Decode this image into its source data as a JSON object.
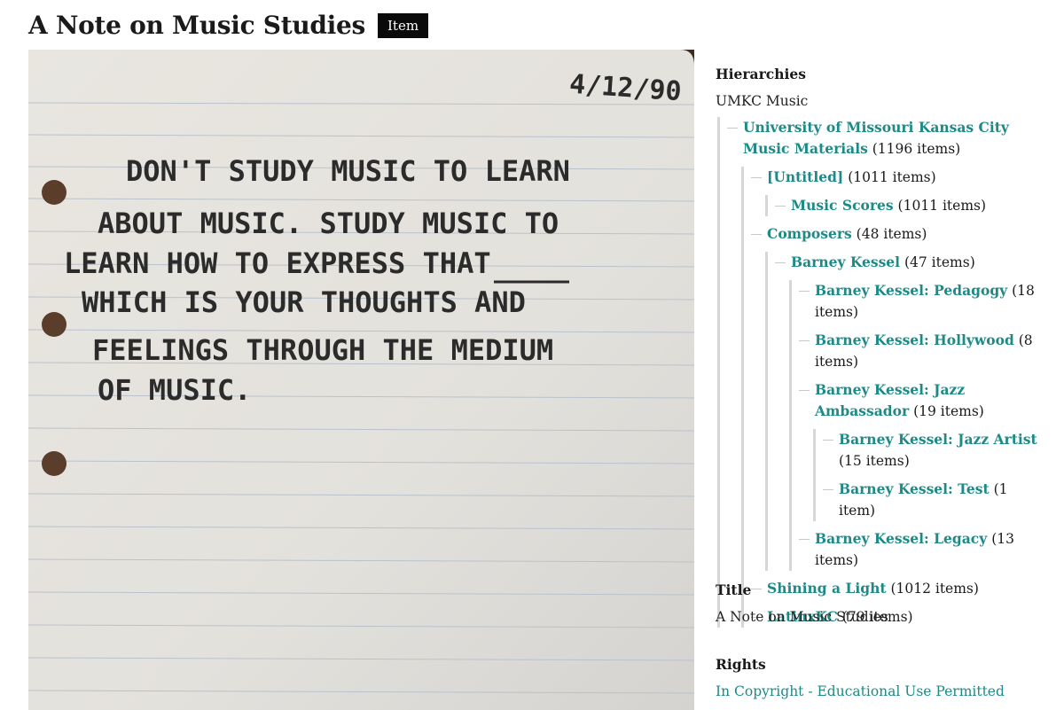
{
  "header": {
    "title": "A Note on Music Studies",
    "badge": "Item"
  },
  "image": {
    "date": "4/12/90",
    "lines": [
      "DON'T STUDY MUSIC TO LEARN",
      "ABOUT MUSIC. STUDY MUSIC TO",
      "LEARN HOW TO EXPRESS THAT",
      "WHICH IS YOUR THOUGHTS AND",
      "FEELINGS THROUGH THE MEDIUM",
      "OF MUSIC."
    ]
  },
  "sidebar": {
    "hierarchies_label": "Hierarchies",
    "root": "UMKC Music",
    "tree": {
      "umkc": {
        "label": "University of Missouri Kansas City Music Materials",
        "count": "(1196 items)"
      },
      "untitled": {
        "label": "[Untitled]",
        "count": "(1011 items)"
      },
      "scores": {
        "label": "Music Scores",
        "count": "(1011 items)"
      },
      "composers": {
        "label": "Composers",
        "count": "(48 items)"
      },
      "kessel": {
        "label": "Barney Kessel",
        "count": "(47 items)"
      },
      "pedagogy": {
        "label": "Barney Kessel: Pedagogy",
        "count": "(18 items)"
      },
      "hollywood": {
        "label": "Barney Kessel: Hollywood",
        "count": "(8 items)"
      },
      "ambassador": {
        "label": "Barney Kessel: Jazz Ambassador",
        "count": "(19 items)"
      },
      "artist": {
        "label": "Barney Kessel: Jazz Artist",
        "count": "(15 items)"
      },
      "test": {
        "label": "Barney Kessel: Test",
        "count": "(1 item)"
      },
      "legacy": {
        "label": "Barney Kessel: Legacy",
        "count": "(13 items)"
      },
      "shining": {
        "label": "Shining a Light",
        "count": "(1012 items)"
      },
      "latinx": {
        "label": "LatinxKC",
        "count": "(79 items)"
      }
    },
    "title_label": "Title",
    "title_value": "A Note on Music Studies",
    "rights_label": "Rights",
    "rights_value": "In Copyright - Educational Use Permitted"
  }
}
